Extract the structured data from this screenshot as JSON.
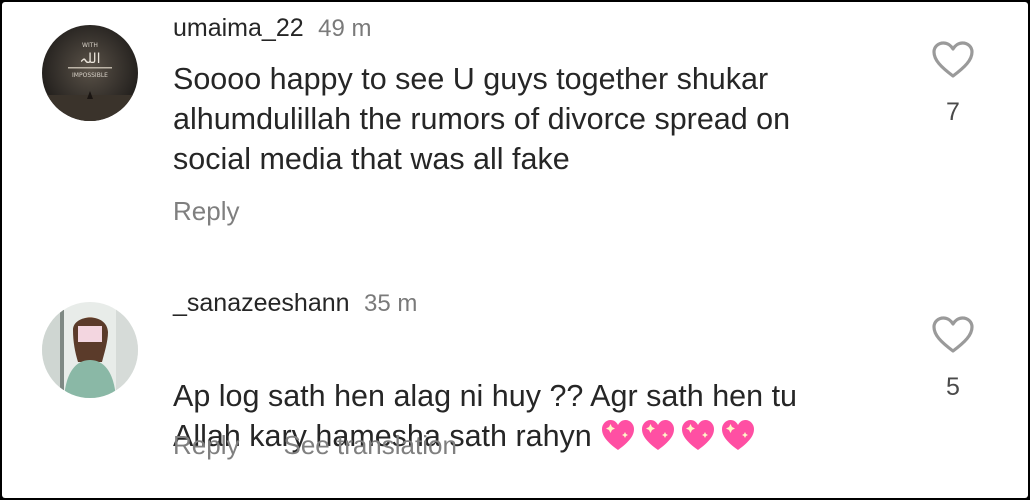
{
  "comments": [
    {
      "username": "umaima_22",
      "time": "49 m",
      "text": "Soooo happy to see U guys together shukar\nalhumdulillah the rumors of divorce spread on\nsocial media that was all fake",
      "likes": "7",
      "reply_label": "Reply",
      "avatar": {
        "top_text": "WITH",
        "arabic_text": "اللہ",
        "bottom_text": "IMPOSSIBLE"
      }
    },
    {
      "username": "_sanazeeshann",
      "time": "35 m",
      "text": "Ap log sath hen alag ni huy ?? Agr sath hen tu\nAllah kary hamesha sath rahyn",
      "emojis": [
        "sparkling-heart",
        "sparkling-heart",
        "sparkling-heart",
        "sparkling-heart"
      ],
      "likes": "5",
      "reply_label": "Reply",
      "translation_label": "See translation"
    }
  ],
  "colors": {
    "text": "#262626",
    "secondary": "#7f7f7f",
    "heart_outline": "#9a9a9a",
    "emoji_pink": "#ff4fa3"
  }
}
